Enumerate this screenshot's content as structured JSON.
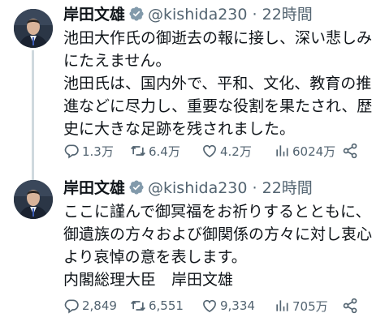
{
  "tweets": [
    {
      "author": "岸田文雄",
      "handle": "@kishida230",
      "time": "22時間",
      "paragraphs": [
        "池田大作氏の御逝去の報に接し、深い悲しみにたえません。",
        "池田氏は、国内外で、平和、文化、教育の推進などに尽力し、重要な役割を果たされ、歴史に大きな足跡を残されました。"
      ],
      "replies": "1.3万",
      "retweets": "6.4万",
      "likes": "4.2万",
      "views": "6024万"
    },
    {
      "author": "岸田文雄",
      "handle": "@kishida230",
      "time": "22時間",
      "paragraphs": [
        "ここに謹んで御冥福をお祈りするとともに、御遺族の方々および御関係の方々に対し衷心より哀悼の意を表します。",
        "内閣総理大臣　岸田文雄"
      ],
      "replies": "2,849",
      "retweets": "6,551",
      "likes": "9,334",
      "views": "705万"
    }
  ],
  "icons": {
    "verified": "verified-badge-icon",
    "reply": "reply-icon",
    "retweet": "retweet-icon",
    "like": "heart-icon",
    "views": "views-icon",
    "share": "share-icon"
  },
  "colors": {
    "text": "#0f1419",
    "secondary": "#536471",
    "verified": "#829aab",
    "thread_line": "#cfd9de"
  }
}
